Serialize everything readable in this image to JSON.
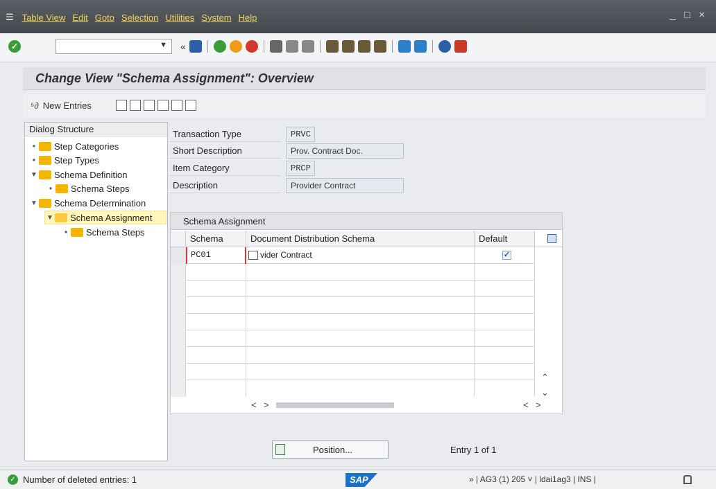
{
  "window": {
    "controls": "_ □ ×"
  },
  "menu": {
    "items": [
      "Table View",
      "Edit",
      "Goto",
      "Selection",
      "Utilities",
      "System",
      "Help"
    ]
  },
  "toolbar": {
    "command_value": "",
    "nav_back_symbol": "«"
  },
  "header": {
    "title": "Change View \"Schema Assignment\": Overview"
  },
  "appbar": {
    "new_entries_label": "New Entries"
  },
  "dialog": {
    "title": "Dialog Structure",
    "nodes": [
      {
        "label": "Step Categories"
      },
      {
        "label": "Step Types"
      },
      {
        "label": "Schema Definition"
      },
      {
        "label": "Schema Steps"
      },
      {
        "label": "Schema Determination"
      },
      {
        "label": "Schema Assignment"
      },
      {
        "label": "Schema Steps"
      }
    ]
  },
  "fields": [
    {
      "label": "Transaction Type",
      "value": "PRVC"
    },
    {
      "label": "Short Description",
      "value": "Prov. Contract Doc."
    },
    {
      "label": "Item Category",
      "value": "PRCP"
    },
    {
      "label": "Description",
      "value": "Provider Contract"
    }
  ],
  "table": {
    "caption": "Schema Assignment",
    "columns": [
      "Schema",
      "Document Distribution Schema",
      "Default"
    ],
    "rows": [
      {
        "schema": "PC01",
        "doc_schema": "vider Contract",
        "default": true
      }
    ],
    "empty_rows": 8
  },
  "position_button": {
    "label": "Position..."
  },
  "entry_info": "Entry 1 of 1",
  "status": {
    "message": "Number of deleted entries: 1",
    "logo": "SAP",
    "system_info": "» | AG3 (1) 205 ˅ | ldai1ag3 | INS |"
  }
}
